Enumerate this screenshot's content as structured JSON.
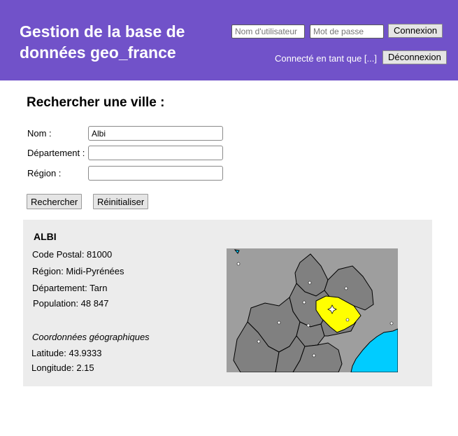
{
  "header": {
    "title": "Gestion de la base de données geo_france",
    "username_placeholder": "Nom d'utilisateur",
    "password_placeholder": "Mot de passe",
    "login_label": "Connexion",
    "logged_in_text": "Connecté en tant que [...]",
    "logout_label": "Déconnexion"
  },
  "search": {
    "title": "Rechercher une ville :",
    "fields": [
      {
        "label": "Nom :",
        "value": "Albi"
      },
      {
        "label": "Département :",
        "value": ""
      },
      {
        "label": "Région :",
        "value": ""
      }
    ],
    "search_label": "Rechercher",
    "reset_label": "Réinitialiser"
  },
  "result": {
    "name": "ALBI",
    "postal_code": "Code Postal: 81000",
    "region": "Région: Midi-Pyrénées",
    "department": "Département: Tarn",
    "population": "Population: 48 847",
    "coords_title": "Coordonnées géographiques",
    "latitude": "Latitude: 43.9333",
    "longitude": "Longitude: 2.15"
  },
  "map": {
    "highlight_color": "#ffff00",
    "department_color": "#808080",
    "background_color": "#9e9e9e",
    "sea_color": "#00ccff"
  }
}
